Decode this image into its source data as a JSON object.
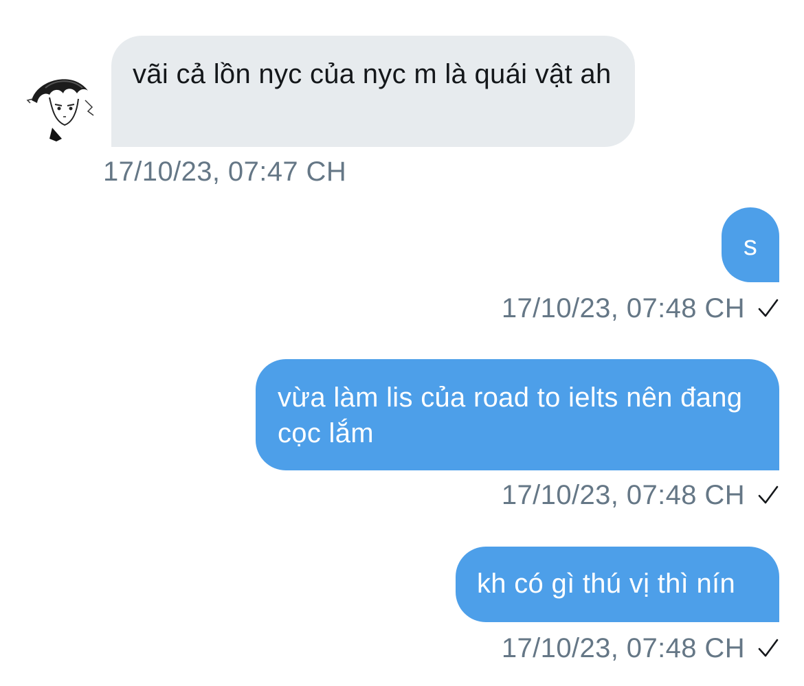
{
  "conversation": {
    "messages": [
      {
        "direction": "incoming",
        "text": "vãi cả lồn nyc của nyc m là quái vật ah",
        "timestamp": "17/10/23, 07:47 CH"
      },
      {
        "direction": "outgoing",
        "text": "s",
        "timestamp": "17/10/23, 07:48 CH",
        "status_icon": "checkmark-icon"
      },
      {
        "direction": "outgoing",
        "text": "vừa làm lis của road to ielts nên đang cọc lắm",
        "timestamp": "17/10/23, 07:48 CH",
        "status_icon": "checkmark-icon"
      },
      {
        "direction": "outgoing",
        "text": "kh có gì thú vị thì nín",
        "timestamp": "17/10/23, 07:48 CH",
        "status_icon": "checkmark-icon"
      }
    ]
  },
  "contact": {
    "avatar_icon": "avatar-manga-drawing"
  },
  "colors": {
    "incoming_bubble": "#e7ebee",
    "outgoing_bubble": "#4d9fe9",
    "timestamp_text": "#657786",
    "incoming_text": "#14171a"
  }
}
